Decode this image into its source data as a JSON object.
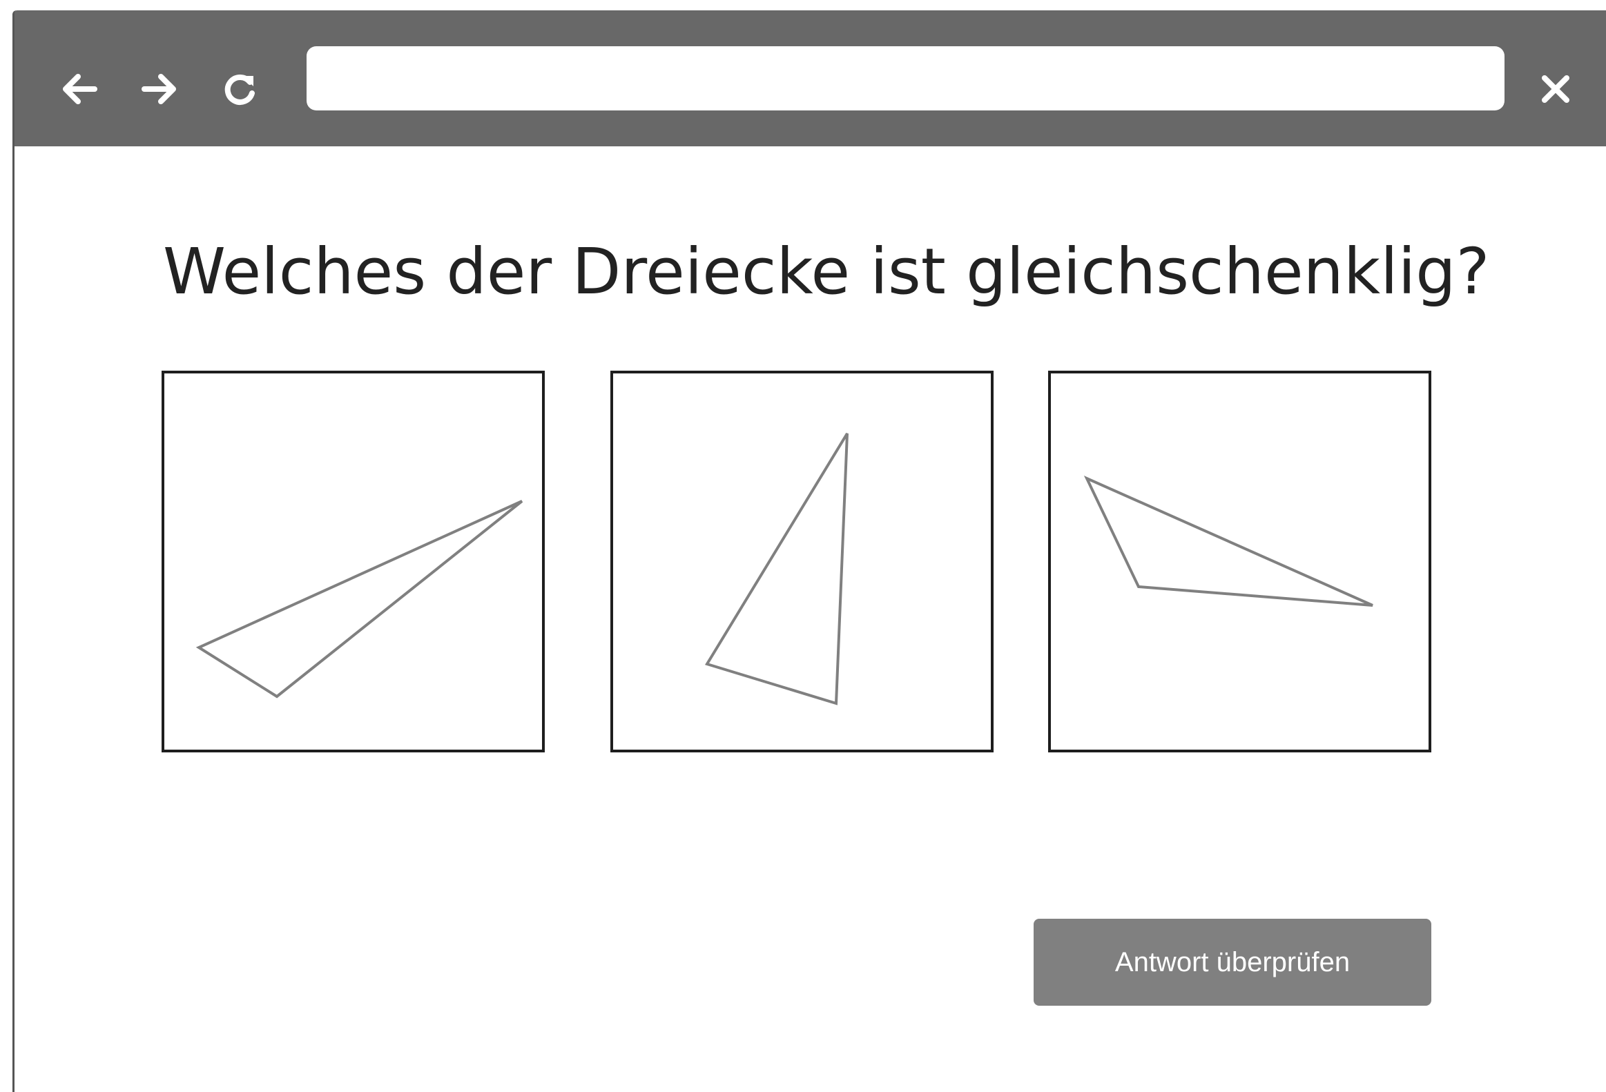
{
  "browser": {
    "address_value": "",
    "icons": {
      "back": "arrow-left-icon",
      "forward": "arrow-right-icon",
      "reload": "reload-icon",
      "close": "close-icon"
    },
    "toolbar_color": "#686868"
  },
  "quiz": {
    "question": "Welches der Dreiecke ist gleichschenklig?",
    "options": [
      {
        "shape": "triangle"
      },
      {
        "shape": "triangle"
      },
      {
        "shape": "triangle"
      }
    ],
    "submit_label": "Antwort überprüfen"
  },
  "colors": {
    "shape_stroke": "#808080",
    "card_border": "#1e1e1e",
    "button_bg": "#808080"
  }
}
